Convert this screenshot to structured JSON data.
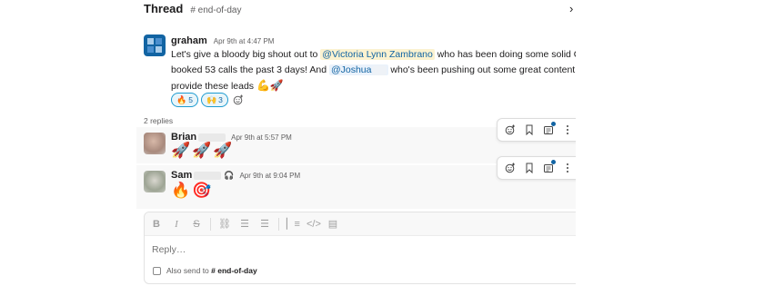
{
  "header": {
    "title": "Thread",
    "channel": "# end-of-day",
    "close_icon": "chevron-right-icon"
  },
  "parent": {
    "author": "graham",
    "time": "Apr 9th at 4:47 PM",
    "line1_prefix": "Let's give a bloody big shout out to",
    "mention1": "@Victoria Lynn Zambrano",
    "line1_suffix": "who has been doing some solid OT &",
    "line2_prefix": "booked 53 calls the past 3 days! And",
    "mention2": "@Joshua",
    "line2_suffix": "who's been pushing out some great content to",
    "line3": "provide these leads",
    "line3_emoji": "💪🚀",
    "reactions": [
      {
        "emoji": "🔥",
        "count": "5"
      },
      {
        "emoji": "🙌",
        "count": "3"
      }
    ]
  },
  "replies_count": "2 replies",
  "replies": [
    {
      "author": "Brian",
      "time": "Apr 9th at 5:57 PM",
      "content": "🚀🚀🚀"
    },
    {
      "author": "Sam",
      "time": "Apr 9th at 9:04 PM",
      "content": "🔥🎯"
    }
  ],
  "toolbar": {
    "icons": [
      "add-reaction-icon",
      "bookmark-icon",
      "forward-icon",
      "more-icon"
    ],
    "accent": "#1264a3"
  },
  "composer": {
    "placeholder": "Reply…",
    "also_send_label": "Also send to",
    "also_send_channel": "# end-of-day",
    "format_icons": [
      "bold-icon",
      "italic-icon",
      "strikethrough-icon",
      "link-icon",
      "ordered-list-icon",
      "bulleted-list-icon",
      "blockquote-icon",
      "code-icon",
      "code-block-icon"
    ]
  }
}
